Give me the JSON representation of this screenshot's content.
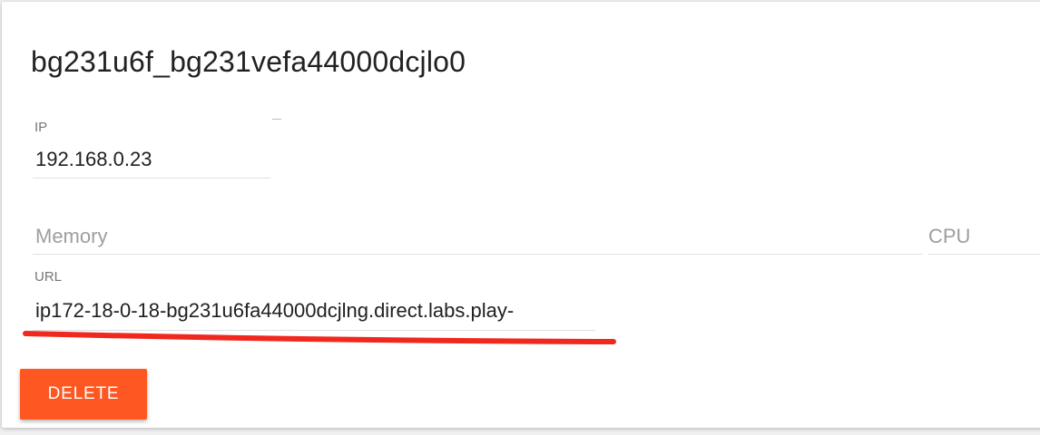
{
  "card": {
    "title": "bg231u6f_bg231vefa44000dcjlo0"
  },
  "fields": {
    "ip": {
      "label": "IP",
      "value": "192.168.0.23"
    },
    "memory": {
      "placeholder": "Memory"
    },
    "cpu": {
      "placeholder": "CPU"
    },
    "url": {
      "label": "URL",
      "value": "ip172-18-0-18-bg231u6fa44000dcjlng.direct.labs.play-"
    }
  },
  "actions": {
    "delete_label": "DELETE"
  },
  "colors": {
    "delete_button": "#ff5722",
    "annotation_underline": "#f0281e"
  }
}
